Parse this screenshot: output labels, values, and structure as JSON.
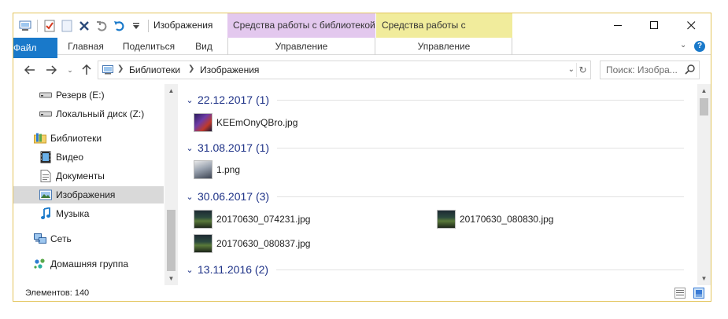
{
  "window": {
    "title": "Изображения",
    "contextual_tabs": [
      "Средства работы с библиотекой",
      "Средства работы с рисунками"
    ],
    "minimize": "─",
    "maximize": "☐",
    "close": "✕"
  },
  "ribbon": {
    "tabs": [
      "Файл",
      "Главная",
      "Поделиться",
      "Вид",
      "Управление",
      "Управление"
    ],
    "help": "?"
  },
  "address": {
    "breadcrumbs": [
      "Библиотеки",
      "Изображения"
    ],
    "search_placeholder": "Поиск: Изобра..."
  },
  "nav": {
    "items": [
      {
        "label": "Резерв (E:)",
        "icon": "drive-icon"
      },
      {
        "label": "Локальный диск (Z:)",
        "icon": "drive-icon"
      },
      {
        "label": "Библиотеки",
        "icon": "libraries-icon"
      },
      {
        "label": "Видео",
        "icon": "video-library-icon"
      },
      {
        "label": "Документы",
        "icon": "documents-icon"
      },
      {
        "label": "Изображения",
        "icon": "pictures-icon",
        "selected": true
      },
      {
        "label": "Музыка",
        "icon": "music-icon"
      },
      {
        "label": "Сеть",
        "icon": "network-icon"
      },
      {
        "label": "Домашняя группа",
        "icon": "homegroup-icon"
      }
    ]
  },
  "groups": [
    {
      "header": "22.12.2017 (1)",
      "files": [
        "KEEmOnyQBro.jpg"
      ]
    },
    {
      "header": "31.08.2017 (1)",
      "files": [
        "1.png"
      ]
    },
    {
      "header": "30.06.2017 (3)",
      "files": [
        "20170630_074231.jpg",
        "20170630_080830.jpg",
        "20170630_080837.jpg"
      ]
    },
    {
      "header": "13.11.2016 (2)",
      "files": []
    }
  ],
  "status": {
    "count": "Элементов: 140"
  },
  "colors": {
    "accent": "#1979ca",
    "library_tools": "#e3c8ee",
    "picture_tools": "#f1ec9c",
    "group_header": "#1e3287",
    "window_border": "#e3c45c"
  }
}
